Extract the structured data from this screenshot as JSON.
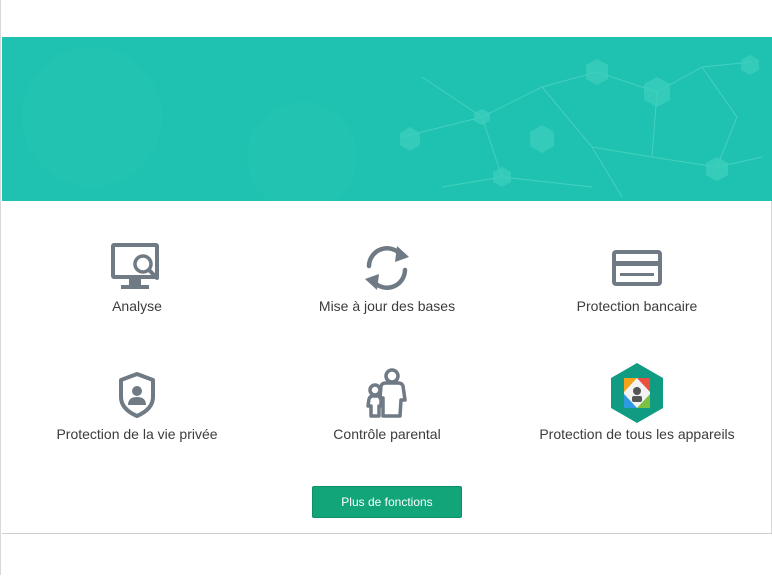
{
  "features": [
    {
      "label": "Analyse",
      "icon": "monitor-search-icon"
    },
    {
      "label": "Mise à jour des bases",
      "icon": "refresh-icon"
    },
    {
      "label": "Protection bancaire",
      "icon": "credit-card-icon"
    },
    {
      "label": "Protection de la vie privée",
      "icon": "shield-user-icon"
    },
    {
      "label": "Contrôle parental",
      "icon": "family-icon"
    },
    {
      "label": "Protection de tous les appareils",
      "icon": "all-devices-icon"
    }
  ],
  "more_button": "Plus de fonctions",
  "colors": {
    "banner": "#1fc2b0",
    "button": "#12a57a",
    "icon": "#6f7a85"
  }
}
